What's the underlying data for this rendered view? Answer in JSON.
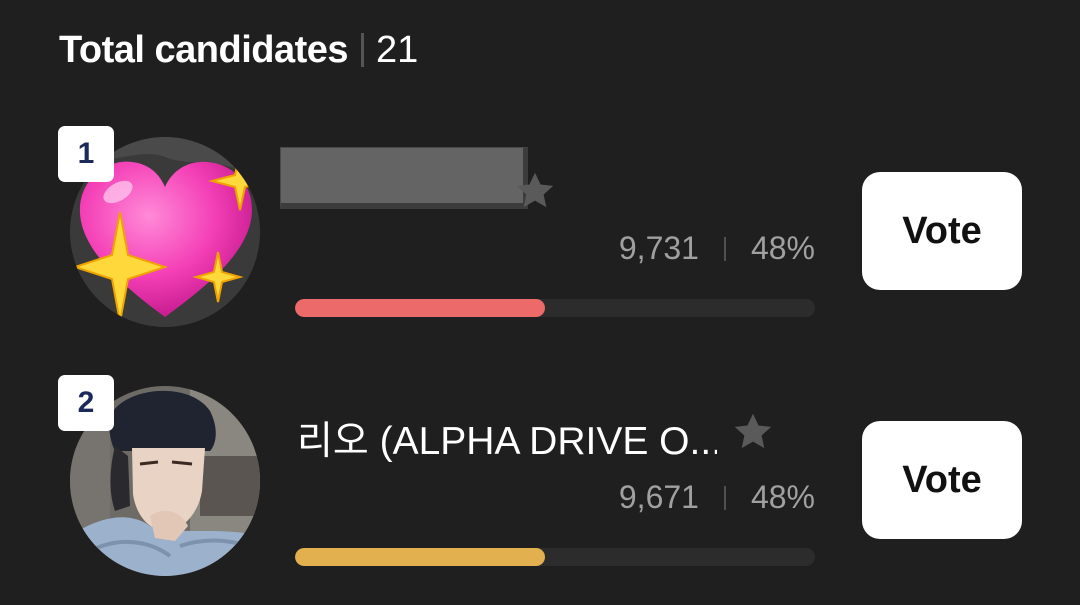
{
  "header": {
    "title": "Total candidates",
    "count": "21"
  },
  "candidates": [
    {
      "rank": "1",
      "name": "",
      "name_redacted": true,
      "votes": "9,731",
      "percent": "48%",
      "share": 0.48,
      "bar_color": "#ec6a6a",
      "vote_label": "Vote",
      "favorite": false,
      "avatar_icon": "sparkling-heart-icon"
    },
    {
      "rank": "2",
      "name": "리오 (ALPHA DRIVE O...",
      "name_redacted": false,
      "votes": "9,671",
      "percent": "48%",
      "share": 0.48,
      "bar_color": "#e2b04f",
      "vote_label": "Vote",
      "favorite": false,
      "avatar_icon": "person-photo"
    }
  ],
  "colors": {
    "background": "#1f1f1f",
    "track": "#2c2c2c",
    "star_inactive": "#5a5a5a"
  }
}
